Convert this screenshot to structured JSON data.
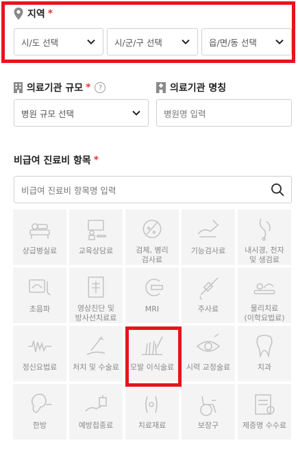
{
  "region": {
    "title": "지역",
    "required": "*",
    "selects": [
      {
        "value": "시/도 선택"
      },
      {
        "value": "시/군/구 선택"
      },
      {
        "value": "읍/면/동 선택"
      }
    ]
  },
  "scale": {
    "title": "의료기관 규모",
    "required": "*",
    "help": "?",
    "select_value": "병원 규모 선택"
  },
  "name": {
    "title": "의료기관 명칭",
    "placeholder": "병원명 입력"
  },
  "items": {
    "title": "비급여 진료비 항목",
    "required": "*",
    "search_placeholder": "비급여 진료비 항목명 입력",
    "categories": [
      {
        "label": "상급병실료",
        "icon": "hospital-bed-icon"
      },
      {
        "label": "교육상담료",
        "icon": "consultation-icon"
      },
      {
        "label": "검체, 병리\n검사료",
        "icon": "specimen-icon"
      },
      {
        "label": "기능검사료",
        "icon": "function-test-icon"
      },
      {
        "label": "내시경, 천자\n및 생검료",
        "icon": "endoscopy-icon"
      },
      {
        "label": "초음파",
        "icon": "ultrasound-icon"
      },
      {
        "label": "영상진단 및\n방사선치료료",
        "icon": "xray-icon"
      },
      {
        "label": "MRI",
        "icon": "mri-icon"
      },
      {
        "label": "주사료",
        "icon": "syringe-icon"
      },
      {
        "label": "물리치료\n(이학요법료)",
        "icon": "physical-therapy-icon"
      },
      {
        "label": "정신요법료",
        "icon": "brainwave-icon"
      },
      {
        "label": "처치 및 수술료",
        "icon": "surgery-icon"
      },
      {
        "label": "모발 이식술료",
        "icon": "hair-transplant-icon"
      },
      {
        "label": "시력 교정술료",
        "icon": "eye-icon"
      },
      {
        "label": "치과",
        "icon": "tooth-icon"
      },
      {
        "label": "한방",
        "icon": "acupuncture-ear-icon"
      },
      {
        "label": "예방접종료",
        "icon": "vaccine-icon"
      },
      {
        "label": "치료재료",
        "icon": "treatment-material-icon"
      },
      {
        "label": "보장구",
        "icon": "wheelchair-icon"
      },
      {
        "label": "제증명 수수료",
        "icon": "certificate-icon"
      }
    ]
  },
  "colors": {
    "required": "#e03a3a",
    "highlight": "#e5151d",
    "tile_bg": "#f4f4f4",
    "icon_gray": "#c4c4c4"
  }
}
